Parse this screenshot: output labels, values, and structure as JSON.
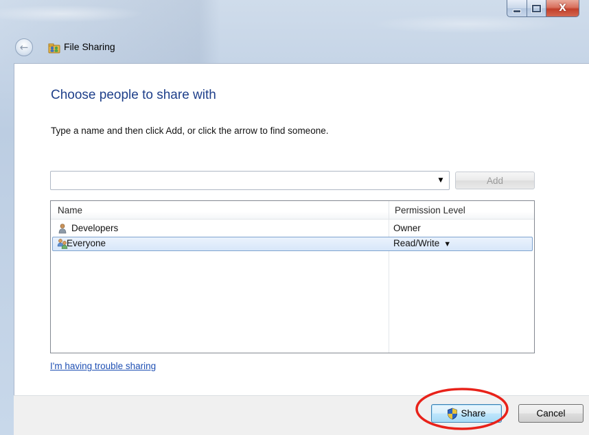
{
  "window": {
    "title": "File Sharing",
    "caption_buttons": {
      "minimize_icon": "minimize-icon",
      "maximize_icon": "maximize-icon",
      "close_icon": "close-icon",
      "close_glyph": "X"
    },
    "back_glyph": "←"
  },
  "content": {
    "heading": "Choose people to share with",
    "instructions": "Type a name and then click Add, or click the arrow to find someone.",
    "name_input": {
      "value": "",
      "placeholder": ""
    },
    "dropdown_glyph": "▼",
    "add_button": "Add",
    "list": {
      "columns": {
        "name": "Name",
        "permission": "Permission Level"
      },
      "rows": [
        {
          "name": "Developers",
          "permission": "Owner",
          "icon": "user-icon",
          "selected": false
        },
        {
          "name": "Everyone",
          "permission": "Read/Write",
          "icon": "group-icon",
          "selected": true,
          "has_dropdown": true
        }
      ],
      "permission_dropdown_glyph": "▼"
    },
    "trouble_link": "I'm having trouble sharing"
  },
  "footer": {
    "share_button": "Share",
    "cancel_button": "Cancel"
  },
  "colors": {
    "heading": "#1e3f8a",
    "link": "#1e4fb3",
    "annotation_ellipse": "#e8221a",
    "selection_border": "#7da2ce"
  }
}
